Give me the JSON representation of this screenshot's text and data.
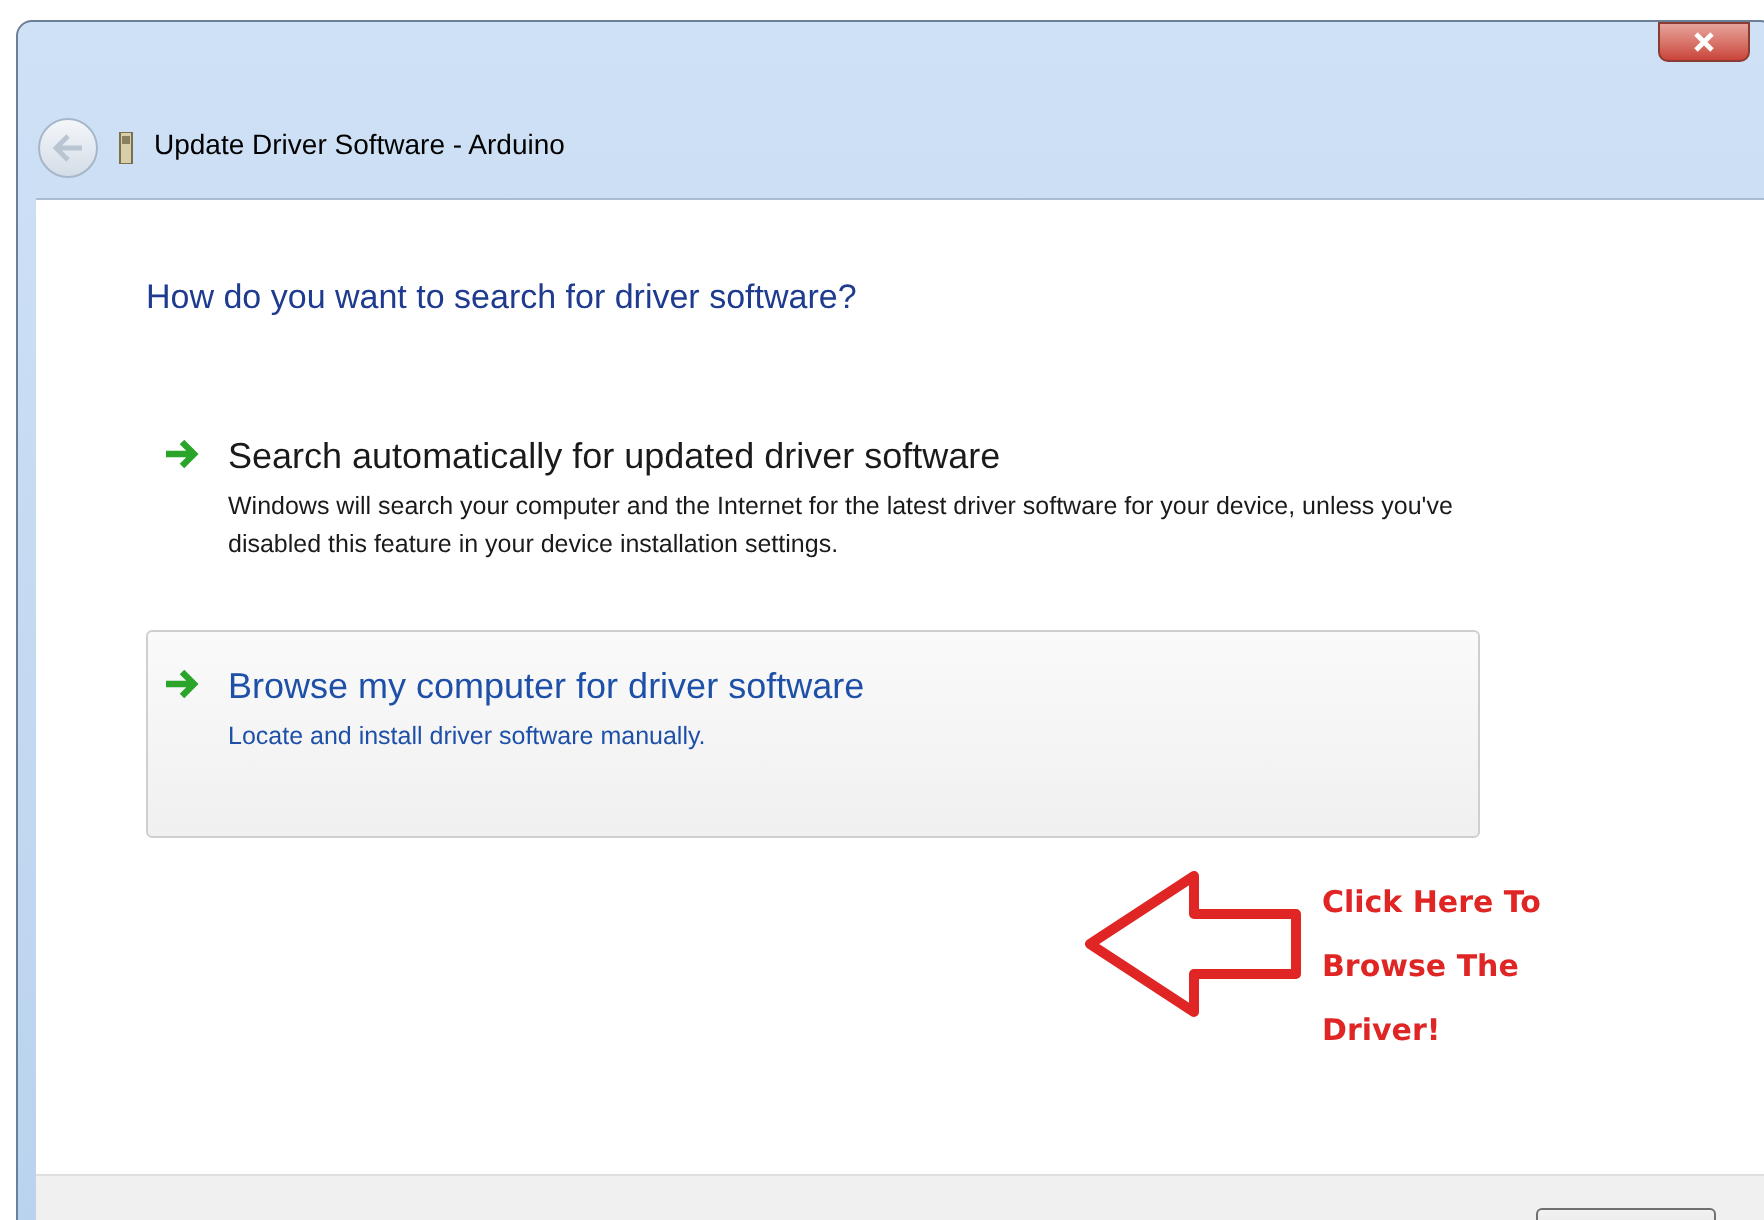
{
  "window": {
    "title": "Update Driver Software - Arduino"
  },
  "heading": "How do you want to search for driver software?",
  "options": [
    {
      "title": "Search automatically for updated driver software",
      "description": "Windows will search your computer and the Internet for the latest driver software for your device, unless you've disabled this feature in your device installation settings.",
      "highlighted": false
    },
    {
      "title": "Browse my computer for driver software",
      "description": "Locate and install driver software manually.",
      "highlighted": true
    }
  ],
  "annotation": {
    "lines": [
      "Click Here To",
      "Browse The",
      "Driver!"
    ]
  }
}
